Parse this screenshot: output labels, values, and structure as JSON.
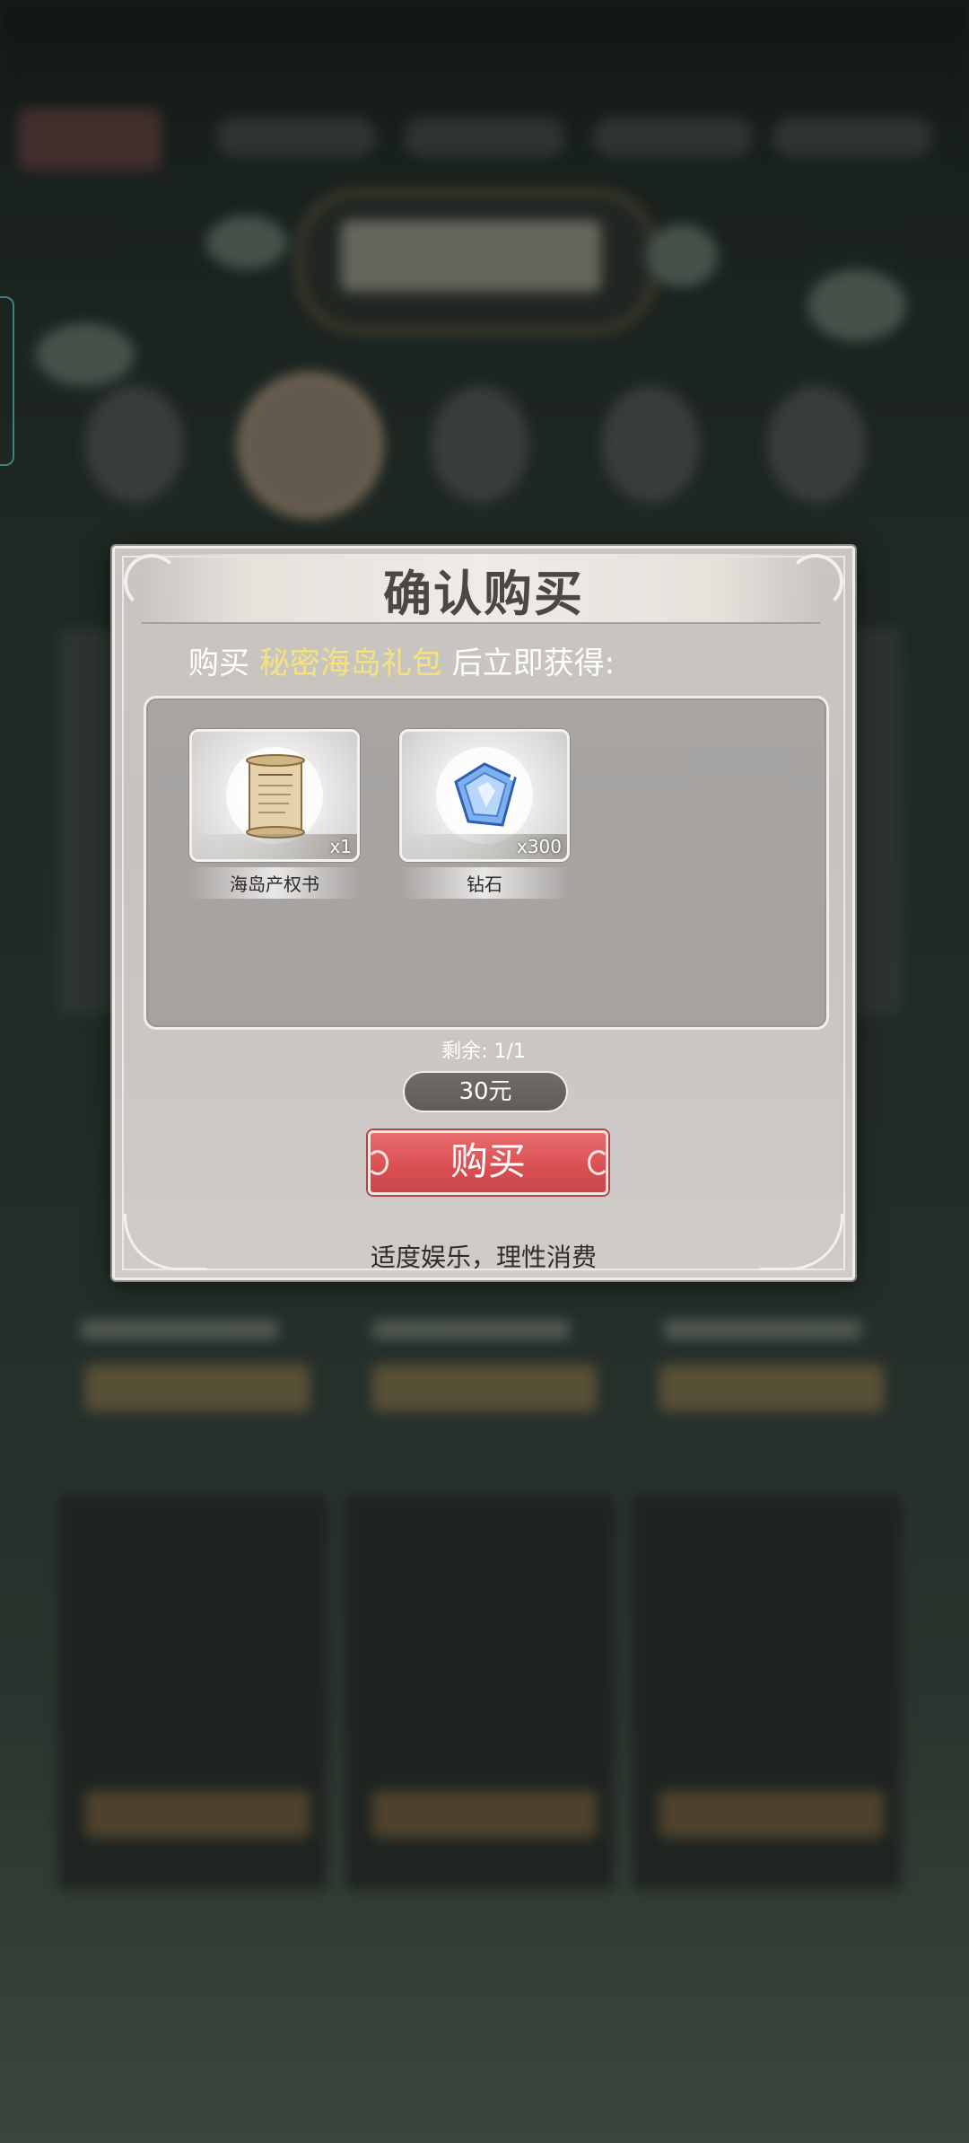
{
  "dialog": {
    "title": "确认购买",
    "subtitle_prefix": "购买",
    "package_name": "秘密海岛礼包",
    "subtitle_suffix": "后立即获得:",
    "items": [
      {
        "name": "海岛产权书",
        "quantity": "x1",
        "icon": "scroll-deed-icon"
      },
      {
        "name": "钻石",
        "quantity": "x300",
        "icon": "diamond-icon"
      }
    ],
    "remaining": "剩余: 1/1",
    "price": "30元",
    "buy_label": "购买",
    "footer_note": "适度娱乐，理性消费"
  },
  "colors": {
    "highlight": "#f6e27a",
    "buy_button": "#d94f52",
    "dialog_bg": "#c9c5c1"
  }
}
